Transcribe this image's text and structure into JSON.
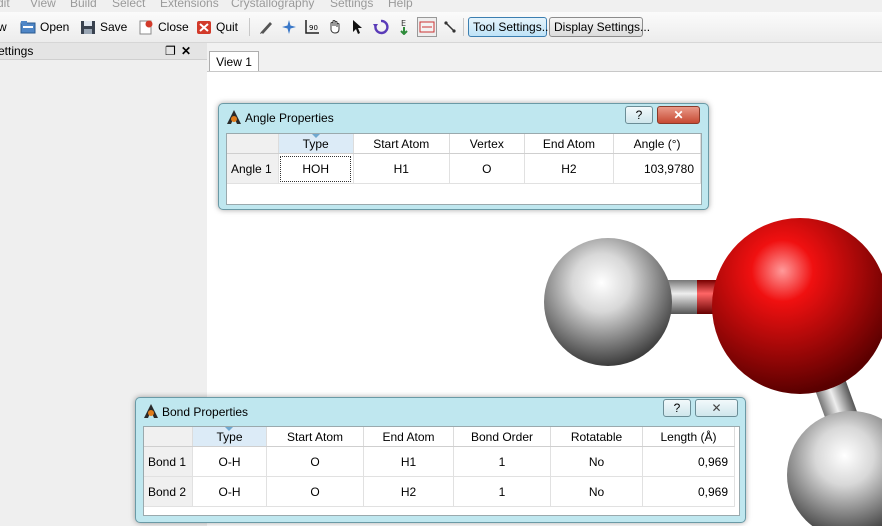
{
  "menu": [
    "dit",
    "View",
    "Build",
    "Select",
    "Extensions",
    "Crystallography",
    "Settings",
    "Help"
  ],
  "toolbar": {
    "new_label": "w",
    "open_label": "Open",
    "save_label": "Save",
    "close_label": "Close",
    "quit_label": "Quit",
    "tool_settings_label": "Tool Settings...",
    "display_settings_label": "Display Settings..."
  },
  "side_panel": {
    "title": "ettings"
  },
  "view": {
    "tab_label": "View 1"
  },
  "angle_dialog": {
    "title": "Angle Properties",
    "help_label": "?",
    "columns": [
      "Type",
      "Start Atom",
      "Vertex",
      "End Atom",
      "Angle (°)"
    ],
    "rows": [
      {
        "label": "Angle 1",
        "type": "HOH",
        "start": "H1",
        "vertex": "O",
        "end": "H2",
        "angle": "103,9780"
      }
    ]
  },
  "bond_dialog": {
    "title": "Bond Properties",
    "help_label": "?",
    "columns": [
      "Type",
      "Start Atom",
      "End Atom",
      "Bond Order",
      "Rotatable",
      "Length (Å)"
    ],
    "rows": [
      {
        "label": "Bond 1",
        "type": "O-H",
        "start": "O",
        "end": "H1",
        "order": "1",
        "rotatable": "No",
        "length": "0,969"
      },
      {
        "label": "Bond 2",
        "type": "O-H",
        "start": "O",
        "end": "H2",
        "order": "1",
        "rotatable": "No",
        "length": "0,969"
      }
    ]
  },
  "colors": {
    "oxygen": "#e0101a",
    "hydrogen": "#dcdcdc",
    "dialog_bg": "#bfe7ef",
    "accent": "#3c7fb1"
  }
}
